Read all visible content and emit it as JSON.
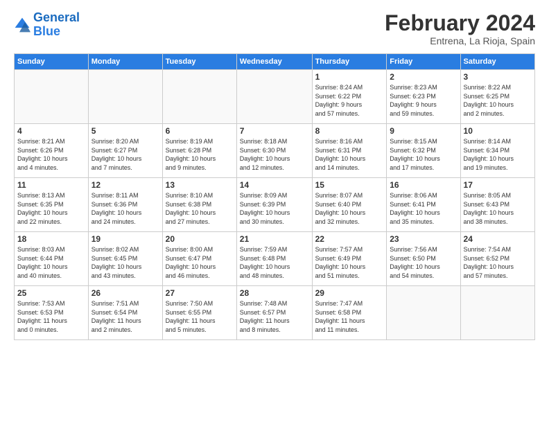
{
  "logo": {
    "text_general": "General",
    "text_blue": "Blue"
  },
  "header": {
    "title": "February 2024",
    "subtitle": "Entrena, La Rioja, Spain"
  },
  "days_of_week": [
    "Sunday",
    "Monday",
    "Tuesday",
    "Wednesday",
    "Thursday",
    "Friday",
    "Saturday"
  ],
  "weeks": [
    [
      {
        "day": "",
        "info": ""
      },
      {
        "day": "",
        "info": ""
      },
      {
        "day": "",
        "info": ""
      },
      {
        "day": "",
        "info": ""
      },
      {
        "day": "1",
        "info": "Sunrise: 8:24 AM\nSunset: 6:22 PM\nDaylight: 9 hours\nand 57 minutes."
      },
      {
        "day": "2",
        "info": "Sunrise: 8:23 AM\nSunset: 6:23 PM\nDaylight: 9 hours\nand 59 minutes."
      },
      {
        "day": "3",
        "info": "Sunrise: 8:22 AM\nSunset: 6:25 PM\nDaylight: 10 hours\nand 2 minutes."
      }
    ],
    [
      {
        "day": "4",
        "info": "Sunrise: 8:21 AM\nSunset: 6:26 PM\nDaylight: 10 hours\nand 4 minutes."
      },
      {
        "day": "5",
        "info": "Sunrise: 8:20 AM\nSunset: 6:27 PM\nDaylight: 10 hours\nand 7 minutes."
      },
      {
        "day": "6",
        "info": "Sunrise: 8:19 AM\nSunset: 6:28 PM\nDaylight: 10 hours\nand 9 minutes."
      },
      {
        "day": "7",
        "info": "Sunrise: 8:18 AM\nSunset: 6:30 PM\nDaylight: 10 hours\nand 12 minutes."
      },
      {
        "day": "8",
        "info": "Sunrise: 8:16 AM\nSunset: 6:31 PM\nDaylight: 10 hours\nand 14 minutes."
      },
      {
        "day": "9",
        "info": "Sunrise: 8:15 AM\nSunset: 6:32 PM\nDaylight: 10 hours\nand 17 minutes."
      },
      {
        "day": "10",
        "info": "Sunrise: 8:14 AM\nSunset: 6:34 PM\nDaylight: 10 hours\nand 19 minutes."
      }
    ],
    [
      {
        "day": "11",
        "info": "Sunrise: 8:13 AM\nSunset: 6:35 PM\nDaylight: 10 hours\nand 22 minutes."
      },
      {
        "day": "12",
        "info": "Sunrise: 8:11 AM\nSunset: 6:36 PM\nDaylight: 10 hours\nand 24 minutes."
      },
      {
        "day": "13",
        "info": "Sunrise: 8:10 AM\nSunset: 6:38 PM\nDaylight: 10 hours\nand 27 minutes."
      },
      {
        "day": "14",
        "info": "Sunrise: 8:09 AM\nSunset: 6:39 PM\nDaylight: 10 hours\nand 30 minutes."
      },
      {
        "day": "15",
        "info": "Sunrise: 8:07 AM\nSunset: 6:40 PM\nDaylight: 10 hours\nand 32 minutes."
      },
      {
        "day": "16",
        "info": "Sunrise: 8:06 AM\nSunset: 6:41 PM\nDaylight: 10 hours\nand 35 minutes."
      },
      {
        "day": "17",
        "info": "Sunrise: 8:05 AM\nSunset: 6:43 PM\nDaylight: 10 hours\nand 38 minutes."
      }
    ],
    [
      {
        "day": "18",
        "info": "Sunrise: 8:03 AM\nSunset: 6:44 PM\nDaylight: 10 hours\nand 40 minutes."
      },
      {
        "day": "19",
        "info": "Sunrise: 8:02 AM\nSunset: 6:45 PM\nDaylight: 10 hours\nand 43 minutes."
      },
      {
        "day": "20",
        "info": "Sunrise: 8:00 AM\nSunset: 6:47 PM\nDaylight: 10 hours\nand 46 minutes."
      },
      {
        "day": "21",
        "info": "Sunrise: 7:59 AM\nSunset: 6:48 PM\nDaylight: 10 hours\nand 48 minutes."
      },
      {
        "day": "22",
        "info": "Sunrise: 7:57 AM\nSunset: 6:49 PM\nDaylight: 10 hours\nand 51 minutes."
      },
      {
        "day": "23",
        "info": "Sunrise: 7:56 AM\nSunset: 6:50 PM\nDaylight: 10 hours\nand 54 minutes."
      },
      {
        "day": "24",
        "info": "Sunrise: 7:54 AM\nSunset: 6:52 PM\nDaylight: 10 hours\nand 57 minutes."
      }
    ],
    [
      {
        "day": "25",
        "info": "Sunrise: 7:53 AM\nSunset: 6:53 PM\nDaylight: 11 hours\nand 0 minutes."
      },
      {
        "day": "26",
        "info": "Sunrise: 7:51 AM\nSunset: 6:54 PM\nDaylight: 11 hours\nand 2 minutes."
      },
      {
        "day": "27",
        "info": "Sunrise: 7:50 AM\nSunset: 6:55 PM\nDaylight: 11 hours\nand 5 minutes."
      },
      {
        "day": "28",
        "info": "Sunrise: 7:48 AM\nSunset: 6:57 PM\nDaylight: 11 hours\nand 8 minutes."
      },
      {
        "day": "29",
        "info": "Sunrise: 7:47 AM\nSunset: 6:58 PM\nDaylight: 11 hours\nand 11 minutes."
      },
      {
        "day": "",
        "info": ""
      },
      {
        "day": "",
        "info": ""
      }
    ]
  ]
}
